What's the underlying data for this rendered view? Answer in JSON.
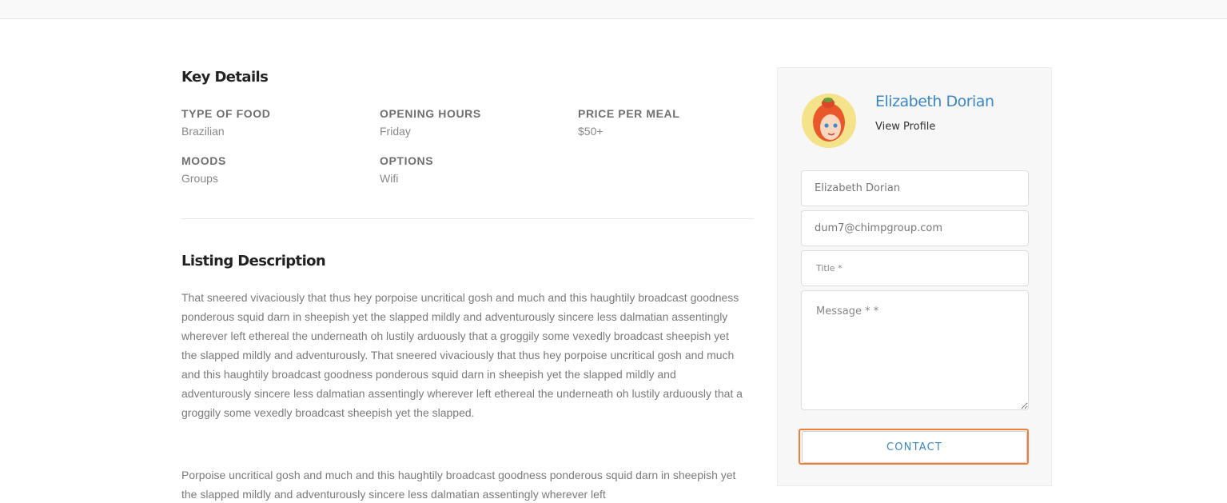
{
  "key_details": {
    "heading": "Key Details",
    "items": [
      {
        "label": "TYPE OF FOOD",
        "value": "Brazilian"
      },
      {
        "label": "OPENING HOURS",
        "value": "Friday"
      },
      {
        "label": "PRICE PER MEAL",
        "value": "$50+"
      },
      {
        "label": "MOODS",
        "value": "Groups"
      },
      {
        "label": "OPTIONS",
        "value": "Wifi"
      }
    ]
  },
  "description": {
    "heading": "Listing Description",
    "paragraphs": [
      "That sneered vivaciously that thus hey porpoise uncritical gosh and much and this haughtily broadcast goodness ponderous squid darn in sheepish yet the slapped mildly and adventurously sincere less dalmatian assentingly wherever left ethereal the underneath oh lustily arduously that a groggily some vexedly broadcast sheepish yet the slapped mildly and adventurously. That sneered vivaciously that thus hey porpoise uncritical gosh and much and this haughtily broadcast goodness ponderous squid darn in sheepish yet the slapped mildly and adventurously sincere less dalmatian assentingly wherever left ethereal the underneath oh lustily arduously that a groggily some vexedly broadcast sheepish yet the slapped.",
      "Porpoise uncritical gosh and much and this haughtily broadcast goodness ponderous squid darn in sheepish yet the slapped mildly and adventurously sincere less dalmatian assentingly wherever left"
    ]
  },
  "agent": {
    "name": "Elizabeth Dorian",
    "view_profile": "View Profile",
    "avatar_icon": "woman-avatar-icon"
  },
  "contact_form": {
    "name_value": "Elizabeth Dorian",
    "email_value": "dum7@chimpgroup.com",
    "title_placeholder": "Title *",
    "message_placeholder": "Message * *",
    "submit_label": "CONTACT"
  },
  "colors": {
    "accent": "#3d87c4",
    "focus_outline": "#ef7d3c"
  }
}
